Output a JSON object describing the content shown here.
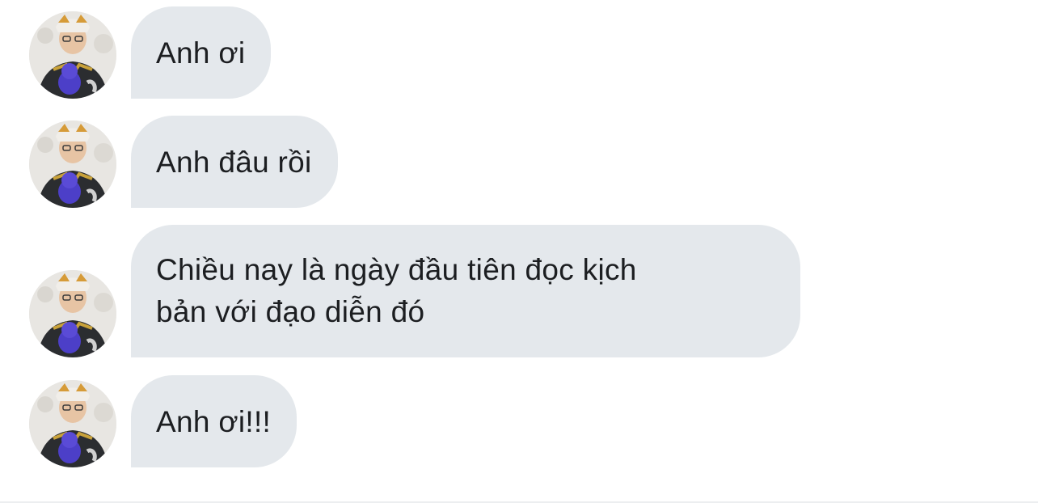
{
  "conversation": {
    "messages": [
      {
        "text": "Anh ơi",
        "avatar_icon": "user-avatar-icon"
      },
      {
        "text": "Anh đâu rồi",
        "avatar_icon": "user-avatar-icon"
      },
      {
        "text": "Chiều nay là ngày đầu tiên đọc kịch\nbản với đạo diễn đó",
        "avatar_icon": "user-avatar-icon"
      },
      {
        "text": "Anh ơi!!!",
        "avatar_icon": "user-avatar-icon"
      }
    ]
  },
  "colors": {
    "bubble_background": "#e4e8ec",
    "text": "#1c1e21",
    "page_background": "#ffffff"
  }
}
